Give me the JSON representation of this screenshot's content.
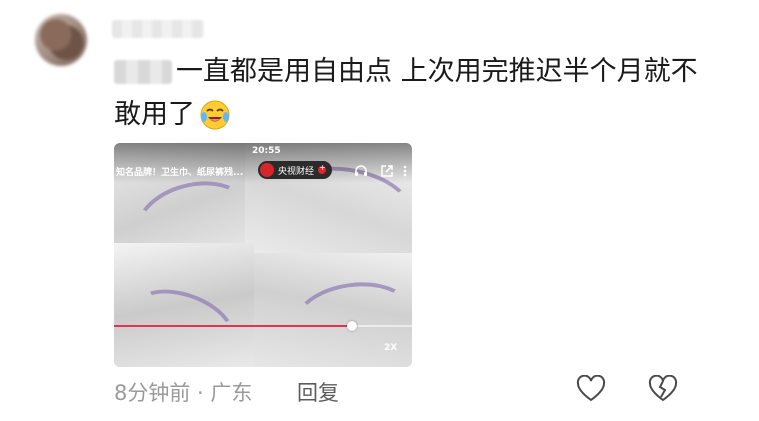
{
  "comment": {
    "text_line1": "一直都是用自由点 上次用完推迟半个月就不",
    "text_line2": "敢用了",
    "emoji": "laughing-with-tears-emoji"
  },
  "video": {
    "status_time": "20:55",
    "title": "知名品牌！卫生巾、纸尿裤残...",
    "channel_name": "央视财经",
    "progress": 0.8,
    "speed": "2X"
  },
  "meta": {
    "time_location": "8分钟前 · 广东",
    "reply_label": "回复"
  },
  "colors": {
    "text": "#1a1a1a",
    "meta": "#9a9a9a",
    "progress": "#e5334d",
    "accent_purple": "#8f7bb3"
  }
}
